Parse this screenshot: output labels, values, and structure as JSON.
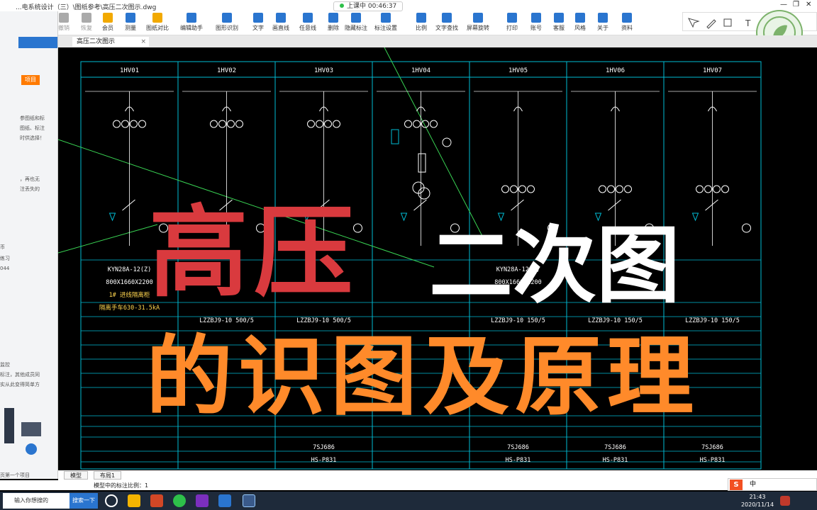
{
  "window": {
    "title": "...电系统设计（三）\\图纸参考\\高压二次图示.dwg",
    "recording": "上课中 00:46:37",
    "controls": [
      "—",
      "❐",
      "✕"
    ]
  },
  "toolbar": [
    {
      "label": "图层管理"
    },
    {
      "label": "撤销"
    },
    {
      "label": "恢复"
    },
    {
      "label": "会员"
    },
    {
      "label": "测量"
    },
    {
      "label": "图纸对比"
    },
    {
      "label": "编辑助手"
    },
    {
      "label": "图形识别"
    },
    {
      "label": "文字"
    },
    {
      "label": "画直线"
    },
    {
      "label": "任意线"
    },
    {
      "label": "删除"
    },
    {
      "label": "隐藏标注"
    },
    {
      "label": "标注设置"
    },
    {
      "label": "比例"
    },
    {
      "label": "文字查找"
    },
    {
      "label": "屏幕旋转"
    },
    {
      "label": "打印"
    },
    {
      "label": "账号"
    },
    {
      "label": "客服"
    },
    {
      "label": "风格"
    },
    {
      "label": "关于"
    },
    {
      "label": "资料"
    }
  ],
  "left_panel": {
    "tab_label": "项目",
    "lines": [
      "参图纸和标",
      "图纸、标注",
      "时供选择！",
      "，再也无",
      "注丢失的",
      "币",
      "练习",
      "044",
      "监控",
      "标注，其他成员同",
      "实从此变得简单方",
      "页第一个项目"
    ]
  },
  "document_tab": {
    "label": "高压二次图示",
    "close": "×"
  },
  "cad": {
    "cabinets": [
      "1HV01",
      "1HV02",
      "1HV03",
      "1HV04",
      "1HV05",
      "1HV06",
      "1HV07"
    ],
    "model_rows": [
      {
        "col": 0,
        "lines": [
          "KYN28A-12(Z)",
          "800X1660X2200",
          "1# 进线隔离柜",
          "隔离手车630-31.5kA"
        ]
      },
      {
        "col": 4,
        "lines": [
          "KYN28A-12(Z)",
          "800X1660X2200"
        ]
      }
    ],
    "ct_labels": [
      "LZZBJ9-10  500/5",
      "LZZBJ9-10  500/5",
      "LZZBJ9-10  150/5",
      "LZZBJ9-10  150/5",
      "LZZBJ9-10  150/5"
    ],
    "relay_labels": [
      "7SJ686",
      "7SJ686",
      "7SJ686",
      "7SJ686"
    ],
    "meter_labels": [
      "HS-P831",
      "HS-P831",
      "HS-P831",
      "HS-P831"
    ]
  },
  "overlay": {
    "line1": "高压",
    "line2": "二次图",
    "line3": "的识图及原理"
  },
  "layout_tabs": [
    "模型",
    "布局1"
  ],
  "status": {
    "scale": "模型中的标注比例：1"
  },
  "taskbar": {
    "search_placeholder": "输入你想搜的",
    "search_button": "搜索一下",
    "time": "21:43",
    "date": "2020/11/14"
  },
  "ime": {
    "label": "中"
  },
  "colors": {
    "accent": "#2a75cf",
    "cad_cyan": "#00bcd4",
    "cad_green": "#39d353",
    "overlay_red": "#d93a3e",
    "overlay_orange": "#ff8a2a"
  }
}
